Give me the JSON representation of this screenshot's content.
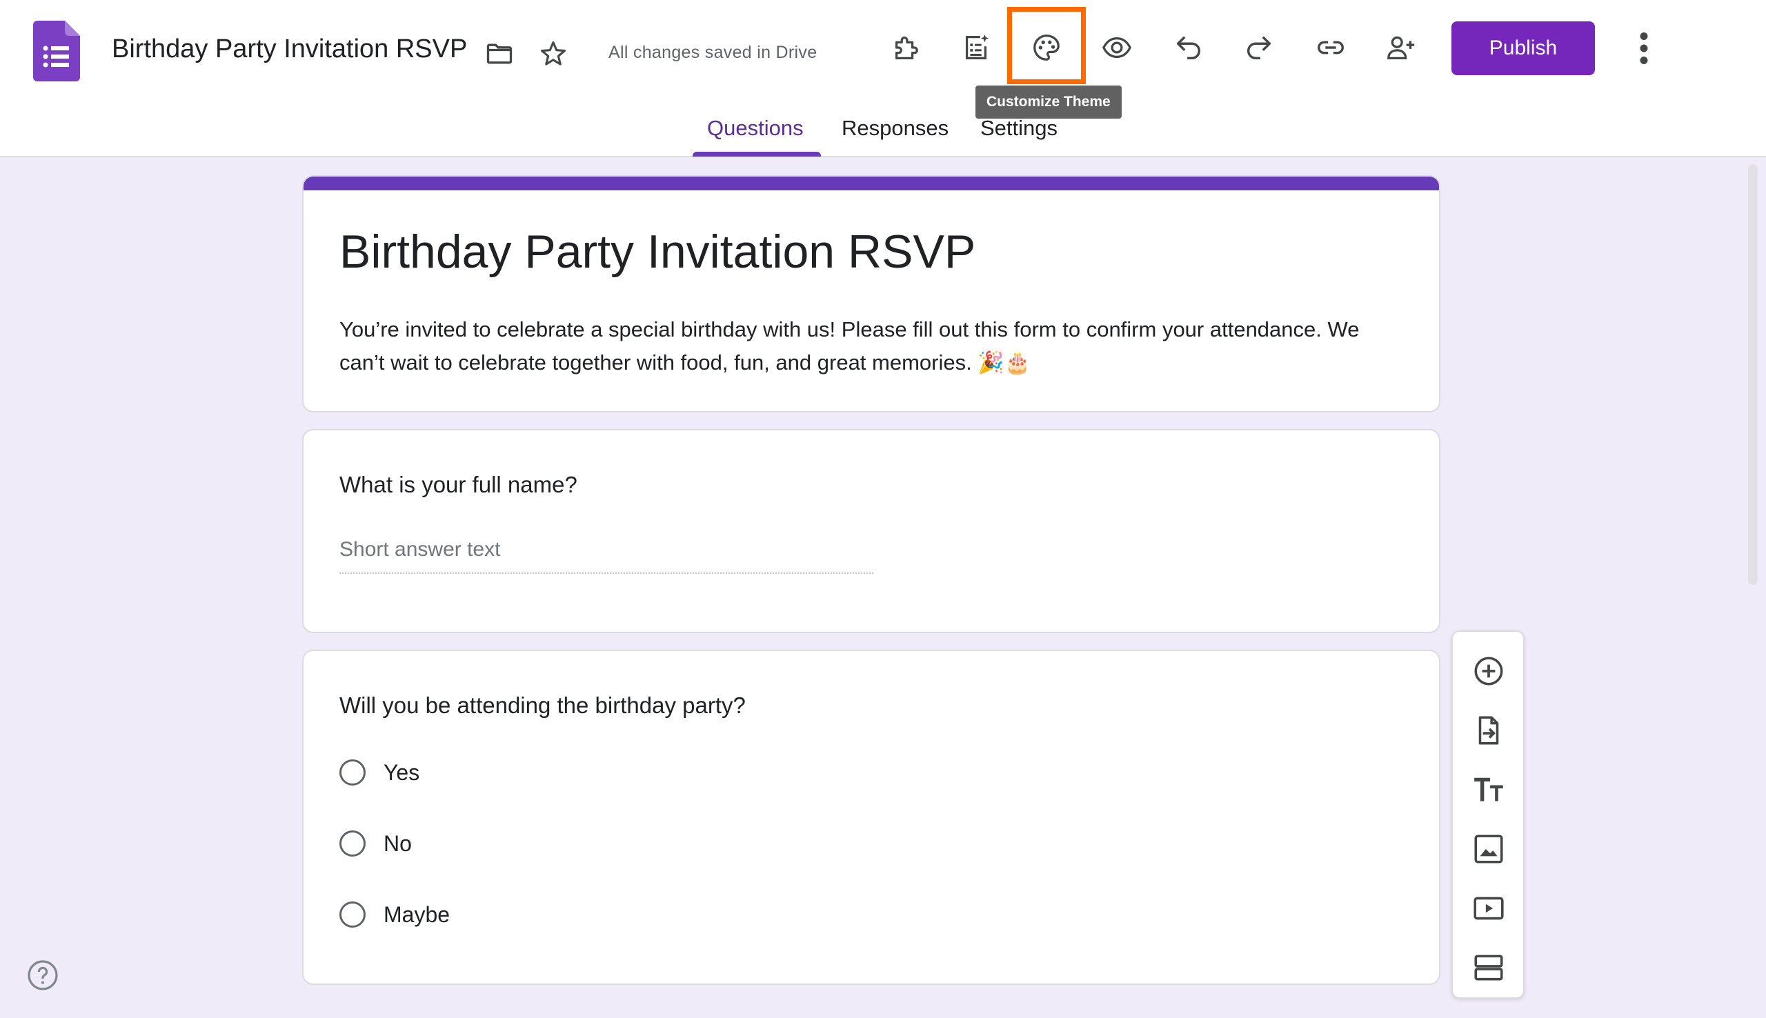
{
  "app": {
    "doc_title": "Birthday Party Invitation RSVP",
    "save_status": "All changes saved in Drive",
    "publish_label": "Publish",
    "tooltip": "Customize Theme",
    "brand_color": "#673ab7",
    "publish_color": "#7627bb",
    "highlight_color": "#ff6a00",
    "background_color": "#f0ebf8"
  },
  "toolbar": {
    "icons": [
      "puzzle-icon",
      "ai-quiz-icon",
      "palette-icon",
      "eye-icon",
      "undo-icon",
      "redo-icon",
      "link-icon",
      "add-person-icon",
      "more-vert-icon"
    ]
  },
  "tabs": [
    {
      "label": "Questions",
      "active": true
    },
    {
      "label": "Responses",
      "active": false
    },
    {
      "label": "Settings",
      "active": false
    }
  ],
  "form": {
    "title": "Birthday Party Invitation RSVP",
    "description": "You’re invited to celebrate a special birthday with us! Please fill out this form to confirm your attendance. We can’t wait to celebrate together with food, fun, and great memories. 🎉🎂"
  },
  "questions": [
    {
      "title": "What is your full name?",
      "placeholder": "Short answer text"
    },
    {
      "title": "Will you be attending the birthday party?",
      "options": [
        "Yes",
        "No",
        "Maybe"
      ]
    }
  ],
  "side_panel": {
    "icons": [
      "add-question-icon",
      "import-questions-icon",
      "add-title-icon",
      "add-image-icon",
      "add-video-icon",
      "add-section-icon"
    ]
  }
}
